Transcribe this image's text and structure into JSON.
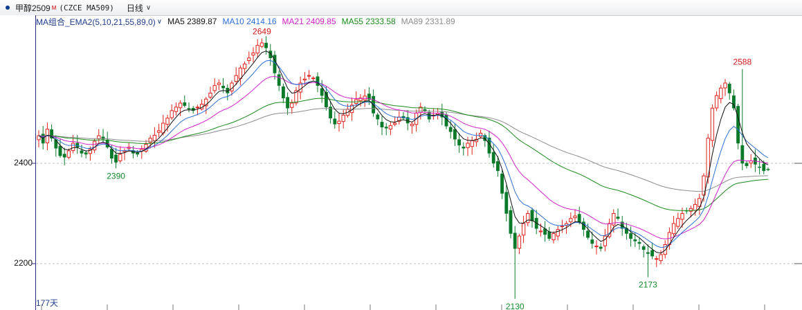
{
  "titlebar": {
    "symbol": "甲醇2509",
    "sup": "M",
    "code": "(CZCE MA509)",
    "period": "日线",
    "caret": "∨"
  },
  "indicator": {
    "name": "MA组合_EMA2(5,10,21,55,89,0)",
    "caret": "∨",
    "ma5": "MA5 2389.87",
    "ma10": "MA10 2414.16",
    "ma21": "MA21 2409.85",
    "ma55": "MA55 2333.58",
    "ma89": "MA89 2331.89"
  },
  "colors": {
    "up": "#e0201a",
    "down": "#0a7a2a",
    "ma5": "#111111",
    "ma10": "#2b6fd6",
    "ma21": "#d021c8",
    "ma55": "#1a8a1a",
    "ma89": "#8c8c8c"
  },
  "bar_count": "177天",
  "chart_data": {
    "type": "candlestick",
    "y_ticks": [
      "2400",
      "2200"
    ],
    "ylim": [
      2130,
      2649
    ],
    "annotations": [
      {
        "label": "2649",
        "value": 2649,
        "kind": "high"
      },
      {
        "label": "2390",
        "value": 2390,
        "kind": "low"
      },
      {
        "label": "2130",
        "value": 2130,
        "kind": "low"
      },
      {
        "label": "2173",
        "value": 2173,
        "kind": "low"
      },
      {
        "label": "2588",
        "value": 2588,
        "kind": "high"
      }
    ],
    "closes": [
      2455,
      2440,
      2468,
      2450,
      2430,
      2415,
      2412,
      2425,
      2440,
      2432,
      2420,
      2418,
      2428,
      2444,
      2455,
      2448,
      2432,
      2410,
      2402,
      2418,
      2425,
      2432,
      2420,
      2418,
      2428,
      2438,
      2450,
      2456,
      2465,
      2480,
      2490,
      2505,
      2512,
      2520,
      2515,
      2508,
      2505,
      2512,
      2518,
      2528,
      2540,
      2555,
      2560,
      2550,
      2540,
      2560,
      2575,
      2590,
      2598,
      2610,
      2620,
      2635,
      2640,
      2630,
      2610,
      2580,
      2555,
      2530,
      2510,
      2520,
      2545,
      2560,
      2568,
      2575,
      2570,
      2555,
      2535,
      2512,
      2490,
      2478,
      2484,
      2496,
      2508,
      2516,
      2527,
      2530,
      2534,
      2527,
      2500,
      2488,
      2472,
      2470,
      2475,
      2480,
      2492,
      2490,
      2480,
      2478,
      2500,
      2512,
      2505,
      2488,
      2496,
      2500,
      2492,
      2474,
      2463,
      2448,
      2436,
      2430,
      2440,
      2445,
      2448,
      2460,
      2445,
      2420,
      2400,
      2385,
      2340,
      2300,
      2260,
      2230,
      2255,
      2280,
      2300,
      2285,
      2270,
      2265,
      2258,
      2250,
      2260,
      2268,
      2275,
      2280,
      2290,
      2295,
      2282,
      2268,
      2252,
      2240,
      2235,
      2230,
      2255,
      2280,
      2300,
      2290,
      2270,
      2260,
      2250,
      2245,
      2240,
      2228,
      2220,
      2215,
      2210,
      2218,
      2238,
      2262,
      2280,
      2290,
      2300,
      2305,
      2310,
      2318,
      2330,
      2375,
      2450,
      2510,
      2535,
      2550,
      2560,
      2540,
      2510,
      2440,
      2400,
      2395,
      2405,
      2398,
      2392,
      2385,
      2388
    ]
  }
}
